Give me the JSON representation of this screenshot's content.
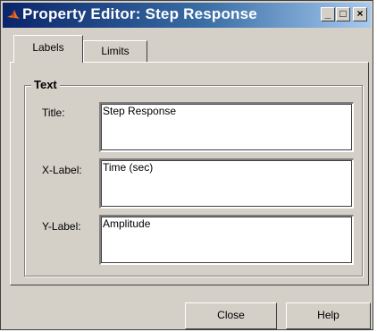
{
  "window": {
    "title": "Property Editor: Step Response",
    "controls": {
      "minimize": "_",
      "maximize": "□",
      "close": "×"
    }
  },
  "tabs": [
    {
      "label": "Labels",
      "active": true
    },
    {
      "label": "Limits",
      "active": false
    }
  ],
  "text_group": {
    "label": "Text",
    "fields": [
      {
        "label": "Title:",
        "value": "Step Response"
      },
      {
        "label": "X-Label:",
        "value": "Time (sec)"
      },
      {
        "label": "Y-Label:",
        "value": "Amplitude"
      }
    ]
  },
  "buttons": {
    "close": "Close",
    "help": "Help"
  },
  "colors": {
    "titlebar_start": "#0a246a",
    "titlebar_end": "#a6caf0",
    "face": "#d4d0c8"
  },
  "icons": {
    "app": "matlab-logo-icon"
  }
}
